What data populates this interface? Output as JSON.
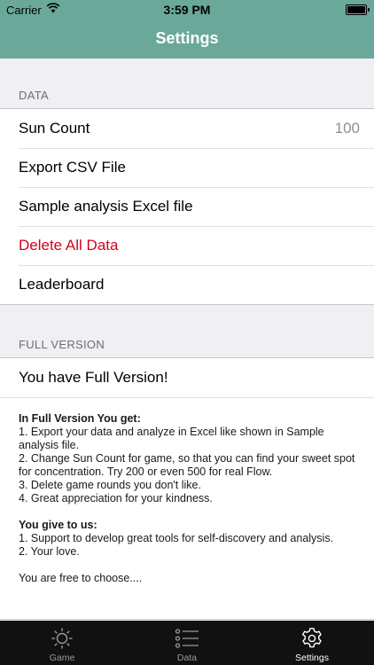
{
  "status": {
    "carrier": "Carrier",
    "time": "3:59 PM"
  },
  "nav": {
    "title": "Settings"
  },
  "data_section": {
    "header": "DATA",
    "rows": [
      {
        "label": "Sun Count",
        "value": "100"
      },
      {
        "label": "Export CSV File"
      },
      {
        "label": "Sample analysis Excel file"
      },
      {
        "label": "Delete All Data"
      },
      {
        "label": "Leaderboard"
      }
    ]
  },
  "full_section": {
    "header": "FULL VERSION",
    "status_row": "You have Full Version!",
    "get_title": "In Full Version You get:",
    "get_items": [
      "1. Export your data and analyze in Excel like shown in Sample analysis file.",
      "2. Change Sun Count for game, so that you can find your sweet spot for concentration. Try 200 or even 500 for real Flow.",
      "3. Delete game rounds you don't like.",
      "4. Great appreciation for your kindness."
    ],
    "give_title": "You give to us:",
    "give_items": [
      "1. Support to develop great tools for self-discovery and analysis.",
      "2. Your love."
    ],
    "closing": "You are free to choose...."
  },
  "tabs": [
    {
      "label": "Game",
      "icon": "sun-icon",
      "active": false
    },
    {
      "label": "Data",
      "icon": "list-icon",
      "active": false
    },
    {
      "label": "Settings",
      "icon": "gear-icon",
      "active": true
    }
  ],
  "colors": {
    "nav_bar": "#6aa99a",
    "destructive": "#d0021b",
    "tab_bar": "#111111"
  }
}
